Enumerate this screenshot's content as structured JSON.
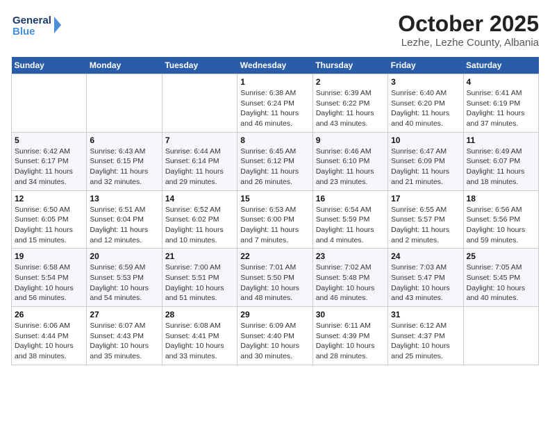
{
  "header": {
    "logo_line1": "General",
    "logo_line2": "Blue",
    "title": "October 2025",
    "subtitle": "Lezhe, Lezhe County, Albania"
  },
  "weekdays": [
    "Sunday",
    "Monday",
    "Tuesday",
    "Wednesday",
    "Thursday",
    "Friday",
    "Saturday"
  ],
  "weeks": [
    [
      {
        "day": "",
        "info": ""
      },
      {
        "day": "",
        "info": ""
      },
      {
        "day": "",
        "info": ""
      },
      {
        "day": "1",
        "info": "Sunrise: 6:38 AM\nSunset: 6:24 PM\nDaylight: 11 hours\nand 46 minutes."
      },
      {
        "day": "2",
        "info": "Sunrise: 6:39 AM\nSunset: 6:22 PM\nDaylight: 11 hours\nand 43 minutes."
      },
      {
        "day": "3",
        "info": "Sunrise: 6:40 AM\nSunset: 6:20 PM\nDaylight: 11 hours\nand 40 minutes."
      },
      {
        "day": "4",
        "info": "Sunrise: 6:41 AM\nSunset: 6:19 PM\nDaylight: 11 hours\nand 37 minutes."
      }
    ],
    [
      {
        "day": "5",
        "info": "Sunrise: 6:42 AM\nSunset: 6:17 PM\nDaylight: 11 hours\nand 34 minutes."
      },
      {
        "day": "6",
        "info": "Sunrise: 6:43 AM\nSunset: 6:15 PM\nDaylight: 11 hours\nand 32 minutes."
      },
      {
        "day": "7",
        "info": "Sunrise: 6:44 AM\nSunset: 6:14 PM\nDaylight: 11 hours\nand 29 minutes."
      },
      {
        "day": "8",
        "info": "Sunrise: 6:45 AM\nSunset: 6:12 PM\nDaylight: 11 hours\nand 26 minutes."
      },
      {
        "day": "9",
        "info": "Sunrise: 6:46 AM\nSunset: 6:10 PM\nDaylight: 11 hours\nand 23 minutes."
      },
      {
        "day": "10",
        "info": "Sunrise: 6:47 AM\nSunset: 6:09 PM\nDaylight: 11 hours\nand 21 minutes."
      },
      {
        "day": "11",
        "info": "Sunrise: 6:49 AM\nSunset: 6:07 PM\nDaylight: 11 hours\nand 18 minutes."
      }
    ],
    [
      {
        "day": "12",
        "info": "Sunrise: 6:50 AM\nSunset: 6:05 PM\nDaylight: 11 hours\nand 15 minutes."
      },
      {
        "day": "13",
        "info": "Sunrise: 6:51 AM\nSunset: 6:04 PM\nDaylight: 11 hours\nand 12 minutes."
      },
      {
        "day": "14",
        "info": "Sunrise: 6:52 AM\nSunset: 6:02 PM\nDaylight: 11 hours\nand 10 minutes."
      },
      {
        "day": "15",
        "info": "Sunrise: 6:53 AM\nSunset: 6:00 PM\nDaylight: 11 hours\nand 7 minutes."
      },
      {
        "day": "16",
        "info": "Sunrise: 6:54 AM\nSunset: 5:59 PM\nDaylight: 11 hours\nand 4 minutes."
      },
      {
        "day": "17",
        "info": "Sunrise: 6:55 AM\nSunset: 5:57 PM\nDaylight: 11 hours\nand 2 minutes."
      },
      {
        "day": "18",
        "info": "Sunrise: 6:56 AM\nSunset: 5:56 PM\nDaylight: 10 hours\nand 59 minutes."
      }
    ],
    [
      {
        "day": "19",
        "info": "Sunrise: 6:58 AM\nSunset: 5:54 PM\nDaylight: 10 hours\nand 56 minutes."
      },
      {
        "day": "20",
        "info": "Sunrise: 6:59 AM\nSunset: 5:53 PM\nDaylight: 10 hours\nand 54 minutes."
      },
      {
        "day": "21",
        "info": "Sunrise: 7:00 AM\nSunset: 5:51 PM\nDaylight: 10 hours\nand 51 minutes."
      },
      {
        "day": "22",
        "info": "Sunrise: 7:01 AM\nSunset: 5:50 PM\nDaylight: 10 hours\nand 48 minutes."
      },
      {
        "day": "23",
        "info": "Sunrise: 7:02 AM\nSunset: 5:48 PM\nDaylight: 10 hours\nand 46 minutes."
      },
      {
        "day": "24",
        "info": "Sunrise: 7:03 AM\nSunset: 5:47 PM\nDaylight: 10 hours\nand 43 minutes."
      },
      {
        "day": "25",
        "info": "Sunrise: 7:05 AM\nSunset: 5:45 PM\nDaylight: 10 hours\nand 40 minutes."
      }
    ],
    [
      {
        "day": "26",
        "info": "Sunrise: 6:06 AM\nSunset: 4:44 PM\nDaylight: 10 hours\nand 38 minutes."
      },
      {
        "day": "27",
        "info": "Sunrise: 6:07 AM\nSunset: 4:43 PM\nDaylight: 10 hours\nand 35 minutes."
      },
      {
        "day": "28",
        "info": "Sunrise: 6:08 AM\nSunset: 4:41 PM\nDaylight: 10 hours\nand 33 minutes."
      },
      {
        "day": "29",
        "info": "Sunrise: 6:09 AM\nSunset: 4:40 PM\nDaylight: 10 hours\nand 30 minutes."
      },
      {
        "day": "30",
        "info": "Sunrise: 6:11 AM\nSunset: 4:39 PM\nDaylight: 10 hours\nand 28 minutes."
      },
      {
        "day": "31",
        "info": "Sunrise: 6:12 AM\nSunset: 4:37 PM\nDaylight: 10 hours\nand 25 minutes."
      },
      {
        "day": "",
        "info": ""
      }
    ]
  ]
}
